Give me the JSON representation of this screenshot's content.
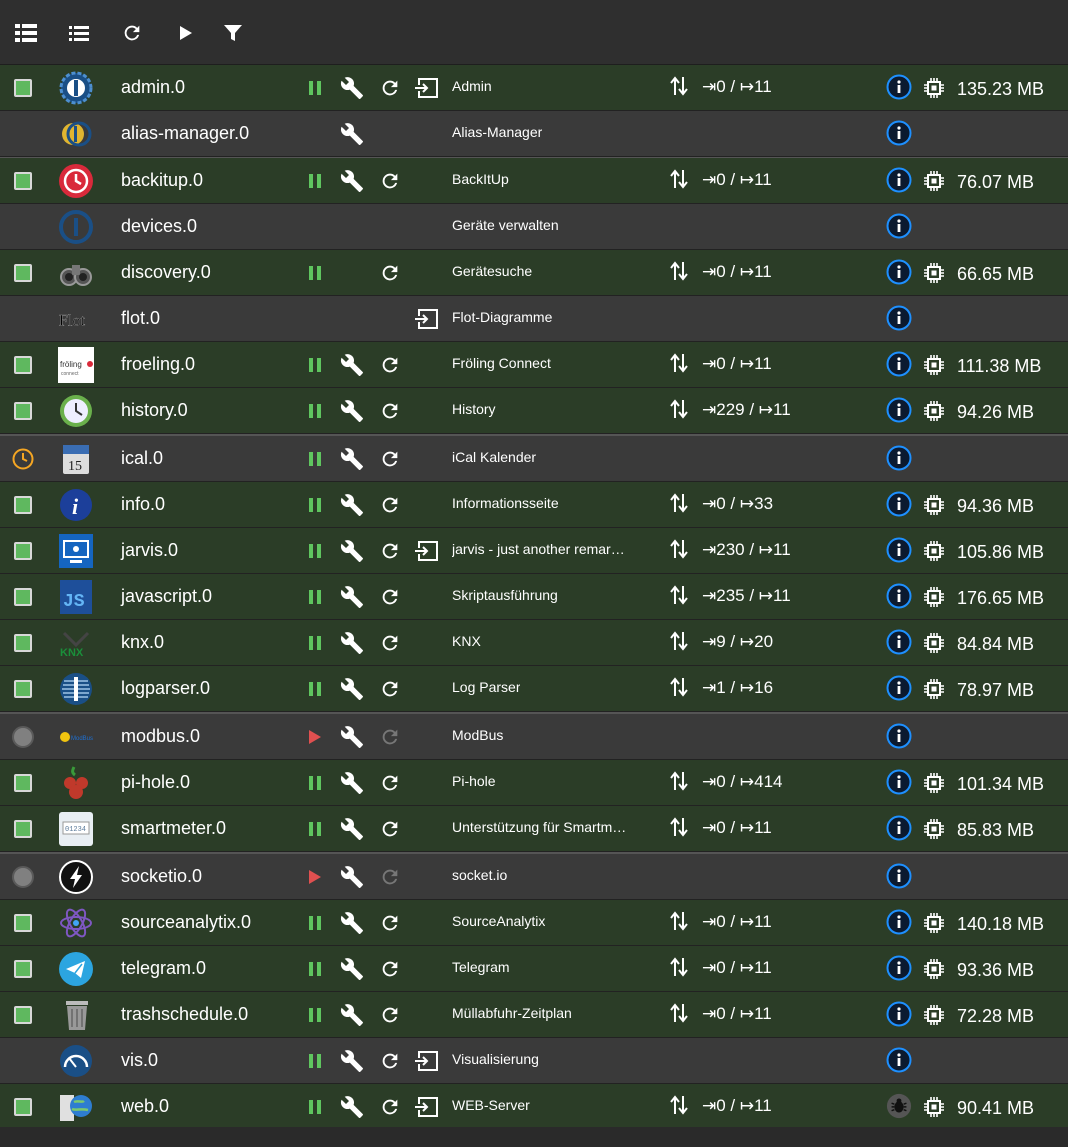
{
  "toolbar": {
    "items": [
      {
        "icon": "list-view-icon"
      },
      {
        "icon": "compact-list-icon"
      },
      {
        "icon": "refresh-icon"
      },
      {
        "icon": "play-icon"
      },
      {
        "icon": "filter-icon"
      }
    ]
  },
  "colors": {
    "row_on": "#2b3d27",
    "row_off": "#3a3a3a",
    "pause_green": "#5fc55f",
    "play_red": "#e05050",
    "info_blue": "#1e90ff"
  },
  "instances": [
    {
      "name": "admin.0",
      "title": "Admin",
      "state": "on",
      "logo": "admin-logo-icon",
      "pause": true,
      "wrench": true,
      "reload": true,
      "link": true,
      "connected": true,
      "events": "⇥0 / ↦11",
      "memory": "135.23 MB"
    },
    {
      "name": "alias-manager.0",
      "title": "Alias-Manager",
      "state": "off",
      "logo": "alias-manager-logo-icon",
      "pause": false,
      "wrench": true,
      "reload": false,
      "link": false,
      "connected": false,
      "events": "",
      "memory": ""
    },
    {
      "name": "backitup.0",
      "title": "BackItUp",
      "state": "on",
      "logo": "backitup-logo-icon",
      "pause": true,
      "wrench": true,
      "reload": true,
      "link": false,
      "connected": true,
      "events": "⇥0 / ↦11",
      "memory": "76.07 MB"
    },
    {
      "name": "devices.0",
      "title": "Geräte verwalten",
      "state": "off",
      "logo": "devices-logo-icon",
      "pause": false,
      "wrench": false,
      "reload": false,
      "link": false,
      "connected": false,
      "events": "",
      "memory": ""
    },
    {
      "name": "discovery.0",
      "title": "Gerätesuche",
      "state": "on",
      "logo": "discovery-logo-icon",
      "pause": true,
      "wrench": false,
      "reload": true,
      "link": false,
      "connected": true,
      "events": "⇥0 / ↦11",
      "memory": "66.65 MB"
    },
    {
      "name": "flot.0",
      "title": "Flot-Diagramme",
      "state": "off",
      "logo": "flot-logo-icon",
      "logo_text": "Flot",
      "pause": false,
      "wrench": false,
      "reload": false,
      "link": true,
      "connected": false,
      "events": "",
      "memory": ""
    },
    {
      "name": "froeling.0",
      "title": "Fröling Connect",
      "state": "on",
      "logo": "froeling-logo-icon",
      "logo_text": "fröling",
      "pause": true,
      "wrench": true,
      "reload": true,
      "link": false,
      "connected": true,
      "events": "⇥0 / ↦11",
      "memory": "111.38 MB"
    },
    {
      "name": "history.0",
      "title": "History",
      "state": "on",
      "logo": "history-logo-icon",
      "pause": true,
      "wrench": true,
      "reload": true,
      "link": false,
      "connected": true,
      "events": "⇥229 / ↦11",
      "memory": "94.26 MB"
    },
    {
      "name": "ical.0",
      "title": "iCal Kalender",
      "state": "scheduled",
      "logo": "ical-logo-icon",
      "logo_text": "15",
      "pause": true,
      "wrench": true,
      "reload": true,
      "link": false,
      "connected": false,
      "events": "",
      "memory": ""
    },
    {
      "name": "info.0",
      "title": "Informationsseite",
      "state": "on",
      "logo": "info-logo-icon",
      "pause": true,
      "wrench": true,
      "reload": true,
      "link": false,
      "connected": true,
      "events": "⇥0 / ↦33",
      "memory": "94.36 MB"
    },
    {
      "name": "jarvis.0",
      "title": "jarvis - just another remarkable vis",
      "state": "on",
      "logo": "jarvis-logo-icon",
      "pause": true,
      "wrench": true,
      "reload": true,
      "link": true,
      "connected": true,
      "events": "⇥230 / ↦11",
      "memory": "105.86 MB"
    },
    {
      "name": "javascript.0",
      "title": "Skriptausführung",
      "state": "on",
      "logo": "javascript-logo-icon",
      "logo_text": "JS",
      "pause": true,
      "wrench": true,
      "reload": true,
      "link": false,
      "connected": true,
      "events": "⇥235 / ↦11",
      "memory": "176.65 MB"
    },
    {
      "name": "knx.0",
      "title": "KNX",
      "state": "on",
      "logo": "knx-logo-icon",
      "logo_text": "KNX",
      "pause": true,
      "wrench": true,
      "reload": true,
      "link": false,
      "connected": true,
      "events": "⇥9 / ↦20",
      "memory": "84.84 MB"
    },
    {
      "name": "logparser.0",
      "title": "Log Parser",
      "state": "on",
      "logo": "logparser-logo-icon",
      "pause": true,
      "wrench": true,
      "reload": true,
      "link": false,
      "connected": true,
      "events": "⇥1 / ↦16",
      "memory": "78.97 MB"
    },
    {
      "name": "modbus.0",
      "title": "ModBus",
      "state": "stopped",
      "logo": "modbus-logo-icon",
      "pause": false,
      "play": true,
      "wrench": true,
      "reload": true,
      "reload_disabled": true,
      "link": false,
      "connected": false,
      "events": "",
      "memory": ""
    },
    {
      "name": "pi-hole.0",
      "title": "Pi-hole",
      "state": "on",
      "logo": "pi-hole-logo-icon",
      "pause": true,
      "wrench": true,
      "reload": true,
      "link": false,
      "connected": true,
      "events": "⇥0 / ↦414",
      "memory": "101.34 MB"
    },
    {
      "name": "smartmeter.0",
      "title": "Unterstützung für Smartmeter",
      "state": "on",
      "logo": "smartmeter-logo-icon",
      "logo_text": "01234",
      "pause": true,
      "wrench": true,
      "reload": true,
      "link": false,
      "connected": true,
      "events": "⇥0 / ↦11",
      "memory": "85.83 MB"
    },
    {
      "name": "socketio.0",
      "title": "socket.io",
      "state": "stopped",
      "logo": "socketio-logo-icon",
      "pause": false,
      "play": true,
      "wrench": true,
      "reload": true,
      "reload_disabled": true,
      "link": false,
      "connected": false,
      "events": "",
      "memory": ""
    },
    {
      "name": "sourceanalytix.0",
      "title": "SourceAnalytix",
      "state": "on",
      "logo": "sourceanalytix-logo-icon",
      "pause": true,
      "wrench": true,
      "reload": true,
      "link": false,
      "connected": true,
      "events": "⇥0 / ↦11",
      "memory": "140.18 MB"
    },
    {
      "name": "telegram.0",
      "title": "Telegram",
      "state": "on",
      "logo": "telegram-logo-icon",
      "pause": true,
      "wrench": true,
      "reload": true,
      "link": false,
      "connected": true,
      "events": "⇥0 / ↦11",
      "memory": "93.36 MB"
    },
    {
      "name": "trashschedule.0",
      "title": "Müllabfuhr-Zeitplan",
      "state": "on",
      "logo": "trashschedule-logo-icon",
      "pause": true,
      "wrench": true,
      "reload": true,
      "link": false,
      "connected": true,
      "events": "⇥0 / ↦11",
      "memory": "72.28 MB"
    },
    {
      "name": "vis.0",
      "title": "Visualisierung",
      "state": "off",
      "logo": "vis-logo-icon",
      "pause": true,
      "wrench": true,
      "reload": true,
      "link": true,
      "connected": false,
      "events": "",
      "memory": ""
    },
    {
      "name": "web.0",
      "title": "WEB-Server",
      "state": "on",
      "logo": "web-logo-icon",
      "pause": true,
      "wrench": true,
      "reload": true,
      "link": true,
      "connected": true,
      "debug": true,
      "events": "⇥0 / ↦11",
      "memory": "90.41 MB"
    }
  ]
}
